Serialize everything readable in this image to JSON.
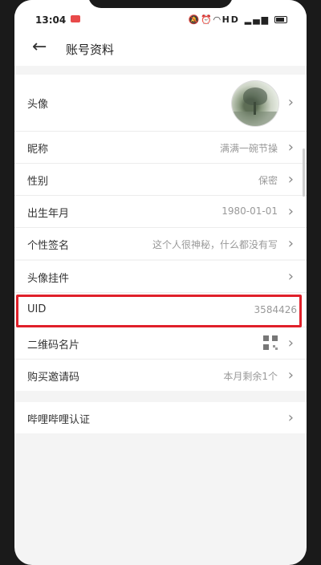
{
  "status": {
    "time": "13:04",
    "network": "HD"
  },
  "header": {
    "back_icon": "arrow-left-icon",
    "title": "账号资料"
  },
  "profile": [
    {
      "label": "头像",
      "value": ""
    },
    {
      "label": "昵称",
      "value": "满满一碗节操"
    },
    {
      "label": "性别",
      "value": "保密"
    },
    {
      "label": "出生年月",
      "value": "1980-01-01"
    },
    {
      "label": "个性签名",
      "value": "这个人很神秘，什么都没有写"
    }
  ],
  "misc": [
    {
      "label": "头像挂件",
      "value": ""
    },
    {
      "label": "UID",
      "value": "3584426"
    },
    {
      "label": "二维码名片",
      "value": ""
    },
    {
      "label": "购买邀请码",
      "value": "本月剩余1个"
    }
  ],
  "verify": {
    "label": "哔哩哔哩认证"
  },
  "colors": {
    "highlight": "#e0202a",
    "background": "#f4f4f4"
  }
}
